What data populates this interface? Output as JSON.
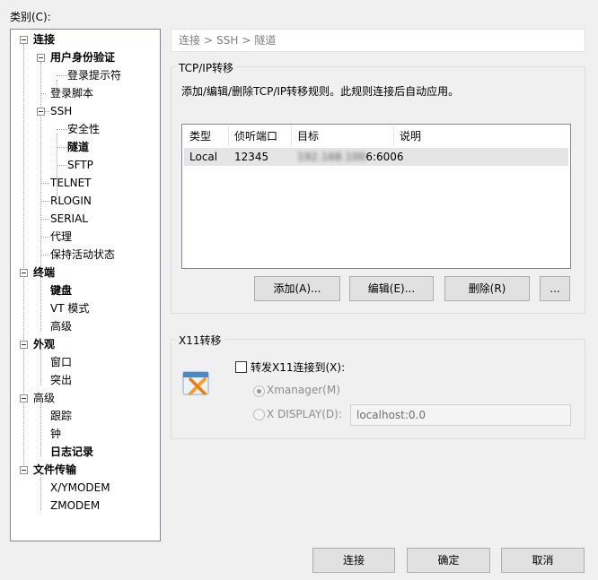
{
  "category_label": "类别(C):",
  "tree": [
    {
      "label": "连接",
      "bold": true
    },
    {
      "label": "用户身份验证",
      "bold": true
    },
    {
      "label": "登录提示符"
    },
    {
      "label": "登录脚本"
    },
    {
      "label": "SSH"
    },
    {
      "label": "安全性"
    },
    {
      "label": "隧道",
      "selected": true
    },
    {
      "label": "SFTP"
    },
    {
      "label": "TELNET"
    },
    {
      "label": "RLOGIN"
    },
    {
      "label": "SERIAL"
    },
    {
      "label": "代理"
    },
    {
      "label": "保持活动状态"
    },
    {
      "label": "终端",
      "bold": true
    },
    {
      "label": "键盘",
      "bold": true
    },
    {
      "label": "VT 模式"
    },
    {
      "label": "高级"
    },
    {
      "label": "外观",
      "bold": true
    },
    {
      "label": "窗口"
    },
    {
      "label": "突出"
    },
    {
      "label": "高级"
    },
    {
      "label": "跟踪"
    },
    {
      "label": "钟"
    },
    {
      "label": "日志记录",
      "bold": true
    },
    {
      "label": "文件传输",
      "bold": true
    },
    {
      "label": "X/YMODEM"
    },
    {
      "label": "ZMODEM"
    }
  ],
  "breadcrumb": {
    "part1": "连接",
    "sep": ">",
    "part2": "SSH",
    "part3": "隧道"
  },
  "tcpip": {
    "title": "TCP/IP转移",
    "description": "添加/编辑/删除TCP/IP转移规则。此规则连接后自动应用。",
    "columns": [
      "类型",
      "侦听端口",
      "目标",
      "说明"
    ],
    "rows": [
      {
        "type": "Local",
        "port": "12345",
        "target_hidden": "192.168.100",
        "target_visible": "6:6006",
        "note": ""
      }
    ],
    "buttons": {
      "add": "添加(A)...",
      "edit": "编辑(E)...",
      "delete": "删除(R)",
      "more": "..."
    }
  },
  "x11": {
    "title": "X11转移",
    "checkbox_label": "转发X11连接到(X):",
    "checked": false,
    "radio_xmanager": "Xmanager(M)",
    "radio_display": "X DISPLAY(D):",
    "display_value": "localhost:0.0",
    "icon": "xmanager-icon"
  },
  "footer": {
    "connect": "连接",
    "ok": "确定",
    "cancel": "取消"
  }
}
